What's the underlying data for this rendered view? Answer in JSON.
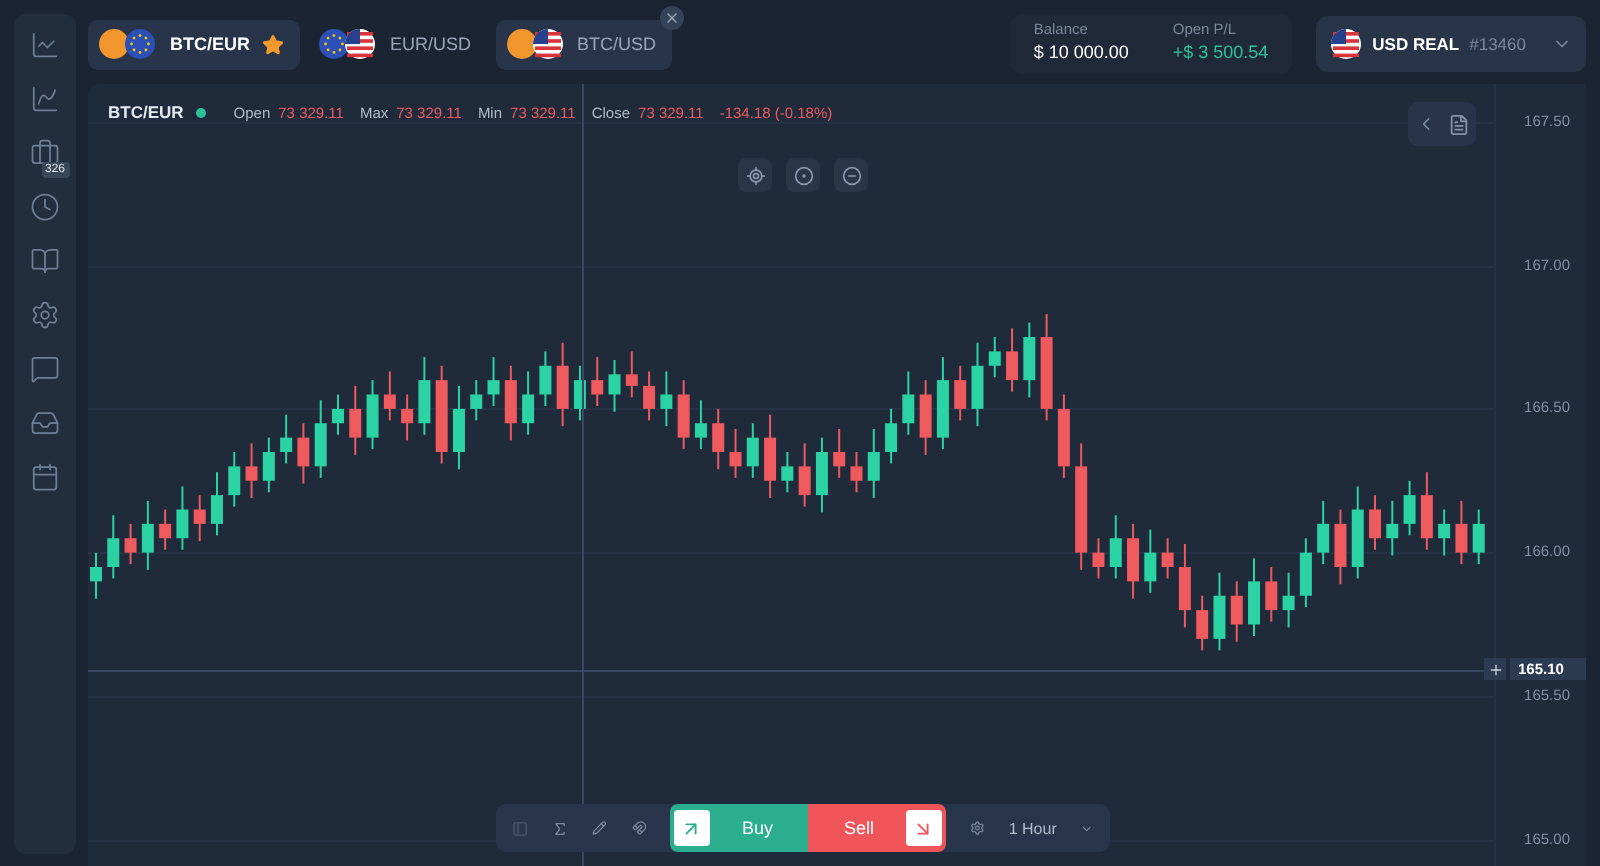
{
  "sidebar": {
    "badge": "326"
  },
  "tabs": [
    {
      "label": "BTC/EUR",
      "kind": "btceur",
      "selected": true,
      "favorite": true,
      "closable": false
    },
    {
      "label": "EUR/USD",
      "kind": "eurusd",
      "selected": false,
      "favorite": false,
      "closable": false
    },
    {
      "label": "BTC/USD",
      "kind": "btcusd",
      "selected": false,
      "favorite": false,
      "closable": true
    }
  ],
  "account": {
    "balance_label": "Balance",
    "balance": "$ 10 000.00",
    "pl_label": "Open P/L",
    "pl": "+$ 3 500.54",
    "name": "USD REAL",
    "number": "#13460"
  },
  "chart": {
    "symbol": "BTC/EUR",
    "live": true,
    "ohlc": [
      {
        "label": "Open",
        "value": "73 329.11"
      },
      {
        "label": "Max",
        "value": "73 329.11"
      },
      {
        "label": "Min",
        "value": "73 329.11"
      },
      {
        "label": "Close",
        "value": "73 329.11"
      }
    ],
    "change": "-134.18 (-0.18%)",
    "crosshair_price": "165.10",
    "chart_data": {
      "type": "candlestick",
      "ohlc": [
        [
          165.9,
          166.0,
          165.84,
          165.95
        ],
        [
          165.95,
          166.13,
          165.91,
          166.05
        ],
        [
          166.05,
          166.1,
          165.96,
          166.0
        ],
        [
          166.0,
          166.18,
          165.94,
          166.1
        ],
        [
          166.1,
          166.15,
          166.01,
          166.05
        ],
        [
          166.05,
          166.23,
          166.01,
          166.15
        ],
        [
          166.15,
          166.2,
          166.04,
          166.1
        ],
        [
          166.1,
          166.28,
          166.06,
          166.2
        ],
        [
          166.2,
          166.35,
          166.16,
          166.3
        ],
        [
          166.3,
          166.38,
          166.19,
          166.25
        ],
        [
          166.25,
          166.4,
          166.21,
          166.35
        ],
        [
          166.35,
          166.48,
          166.31,
          166.4
        ],
        [
          166.4,
          166.45,
          166.24,
          166.3
        ],
        [
          166.3,
          166.53,
          166.26,
          166.45
        ],
        [
          166.45,
          166.55,
          166.41,
          166.5
        ],
        [
          166.5,
          166.58,
          166.34,
          166.4
        ],
        [
          166.4,
          166.6,
          166.36,
          166.55
        ],
        [
          166.55,
          166.63,
          166.46,
          166.5
        ],
        [
          166.5,
          166.55,
          166.39,
          166.45
        ],
        [
          166.45,
          166.68,
          166.41,
          166.6
        ],
        [
          166.6,
          166.65,
          166.31,
          166.35
        ],
        [
          166.35,
          166.58,
          166.29,
          166.5
        ],
        [
          166.5,
          166.6,
          166.46,
          166.55
        ],
        [
          166.55,
          166.68,
          166.51,
          166.6
        ],
        [
          166.6,
          166.65,
          166.39,
          166.45
        ],
        [
          166.45,
          166.63,
          166.41,
          166.55
        ],
        [
          166.55,
          166.7,
          166.51,
          166.65
        ],
        [
          166.65,
          166.73,
          166.44,
          166.5
        ],
        [
          166.5,
          166.65,
          166.46,
          166.6
        ],
        [
          166.6,
          166.68,
          166.51,
          166.55
        ],
        [
          166.55,
          166.67,
          166.49,
          166.62
        ],
        [
          166.62,
          166.7,
          166.54,
          166.58
        ],
        [
          166.58,
          166.63,
          166.46,
          166.5
        ],
        [
          166.5,
          166.63,
          166.44,
          166.55
        ],
        [
          166.55,
          166.6,
          166.36,
          166.4
        ],
        [
          166.4,
          166.53,
          166.36,
          166.45
        ],
        [
          166.45,
          166.5,
          166.29,
          166.35
        ],
        [
          166.35,
          166.43,
          166.26,
          166.3
        ],
        [
          166.3,
          166.45,
          166.26,
          166.4
        ],
        [
          166.4,
          166.48,
          166.19,
          166.25
        ],
        [
          166.25,
          166.35,
          166.21,
          166.3
        ],
        [
          166.3,
          166.38,
          166.16,
          166.2
        ],
        [
          166.2,
          166.4,
          166.14,
          166.35
        ],
        [
          166.35,
          166.43,
          166.26,
          166.3
        ],
        [
          166.3,
          166.35,
          166.21,
          166.25
        ],
        [
          166.25,
          166.43,
          166.19,
          166.35
        ],
        [
          166.35,
          166.5,
          166.31,
          166.45
        ],
        [
          166.45,
          166.63,
          166.41,
          166.55
        ],
        [
          166.55,
          166.6,
          166.34,
          166.4
        ],
        [
          166.4,
          166.68,
          166.36,
          166.6
        ],
        [
          166.6,
          166.65,
          166.46,
          166.5
        ],
        [
          166.5,
          166.73,
          166.44,
          166.65
        ],
        [
          166.65,
          166.75,
          166.61,
          166.7
        ],
        [
          166.7,
          166.78,
          166.56,
          166.6
        ],
        [
          166.6,
          166.8,
          166.54,
          166.75
        ],
        [
          166.75,
          166.83,
          166.46,
          166.5
        ],
        [
          166.5,
          166.55,
          166.26,
          166.3
        ],
        [
          166.3,
          166.38,
          165.94,
          166.0
        ],
        [
          166.0,
          166.05,
          165.91,
          165.95
        ],
        [
          165.95,
          166.13,
          165.91,
          166.05
        ],
        [
          166.05,
          166.1,
          165.84,
          165.9
        ],
        [
          165.9,
          166.08,
          165.86,
          166.0
        ],
        [
          166.0,
          166.05,
          165.91,
          165.95
        ],
        [
          165.95,
          166.03,
          165.74,
          165.8
        ],
        [
          165.8,
          165.85,
          165.66,
          165.7
        ],
        [
          165.7,
          165.93,
          165.66,
          165.85
        ],
        [
          165.85,
          165.9,
          165.69,
          165.75
        ],
        [
          165.75,
          165.98,
          165.71,
          165.9
        ],
        [
          165.9,
          165.95,
          165.76,
          165.8
        ],
        [
          165.8,
          165.93,
          165.74,
          165.85
        ],
        [
          165.85,
          166.05,
          165.81,
          166.0
        ],
        [
          166.0,
          166.18,
          165.96,
          166.1
        ],
        [
          166.1,
          166.15,
          165.89,
          165.95
        ],
        [
          165.95,
          166.23,
          165.91,
          166.15
        ],
        [
          166.15,
          166.2,
          166.01,
          166.05
        ],
        [
          166.05,
          166.18,
          165.99,
          166.1
        ],
        [
          166.1,
          166.25,
          166.06,
          166.2
        ],
        [
          166.2,
          166.28,
          166.01,
          166.05
        ],
        [
          166.05,
          166.15,
          165.99,
          166.1
        ],
        [
          166.1,
          166.18,
          165.96,
          166.0
        ],
        [
          166.0,
          166.15,
          165.96,
          166.1
        ]
      ],
      "ylim": [
        164.91,
        167.63
      ],
      "yticks": [
        {
          "value": 167.5,
          "label": "167.50"
        },
        {
          "value": 167.0,
          "label": "167.00"
        },
        {
          "value": 166.5,
          "label": "166.50"
        },
        {
          "value": 166.0,
          "label": "166.00"
        },
        {
          "value": 165.5,
          "label": "165.50"
        },
        {
          "value": 165.0,
          "label": "165.00"
        }
      ]
    }
  },
  "toolbar": {
    "buy": "Buy",
    "sell": "Sell",
    "interval": "1 Hour"
  }
}
